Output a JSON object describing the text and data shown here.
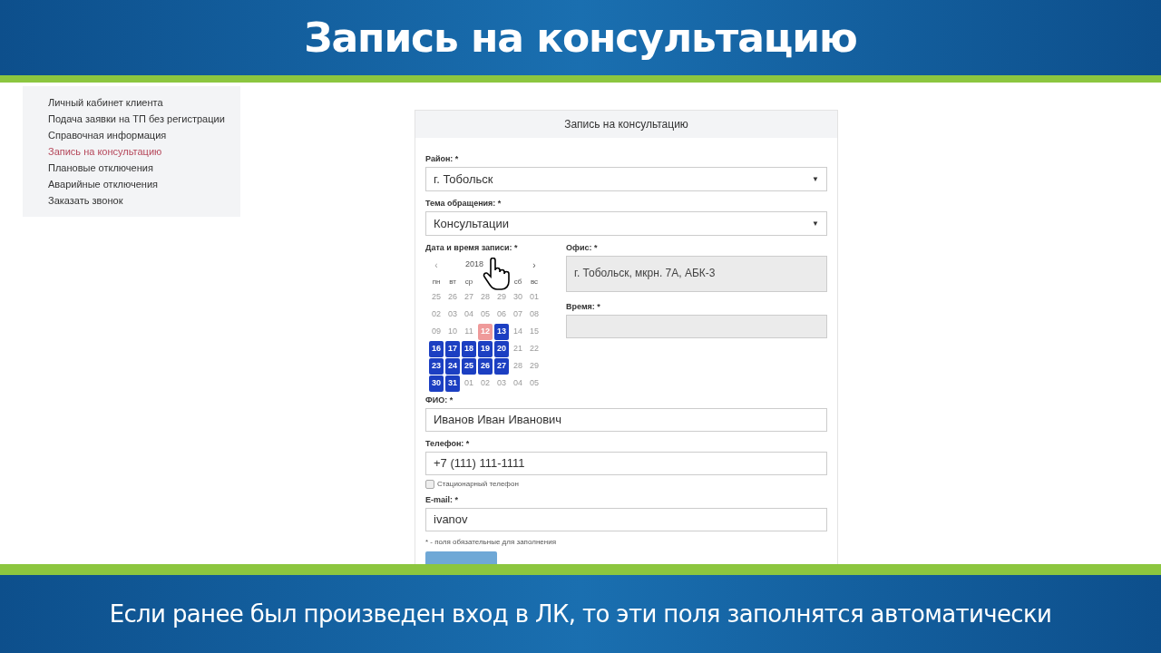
{
  "header": {
    "title": "Запись на консультацию"
  },
  "sidebar": {
    "items": [
      {
        "label": "Личный кабинет клиента",
        "selected": false
      },
      {
        "label": "Подача заявки на ТП без регистрации",
        "selected": false
      },
      {
        "label": "Справочная информация",
        "selected": false
      },
      {
        "label": "Запись на консультацию",
        "selected": true
      },
      {
        "label": "Плановые отключения",
        "selected": false
      },
      {
        "label": "Аварийные отключения",
        "selected": false
      },
      {
        "label": "Заказать звонок",
        "selected": false
      }
    ]
  },
  "form": {
    "title": "Запись на консультацию",
    "district": {
      "label": "Район: *",
      "value": "г. Тобольск",
      "caret": "▼"
    },
    "topic": {
      "label": "Тема обращения: *",
      "value": "Консультации",
      "caret": "▼"
    },
    "datetime": {
      "label": "Дата и время записи: *",
      "calendar": {
        "title": "2018",
        "prev": "‹",
        "next": "›",
        "weekdays": [
          {
            "kind": "label",
            "label": "пн"
          },
          {
            "kind": "label",
            "label": "вт"
          },
          {
            "kind": "label",
            "label": "ср"
          },
          {
            "kind": "covered"
          },
          {
            "kind": "covered"
          },
          {
            "kind": "label",
            "label": "сб"
          },
          {
            "kind": "label",
            "label": "вс"
          }
        ],
        "days": [
          {
            "label": "25",
            "kind": "inactive"
          },
          {
            "label": "26",
            "kind": "inactive"
          },
          {
            "label": "27",
            "kind": "inactive"
          },
          {
            "label": "28",
            "kind": "inactive"
          },
          {
            "label": "29",
            "kind": "inactive"
          },
          {
            "label": "30",
            "kind": "inactive"
          },
          {
            "label": "01",
            "kind": "inactive"
          },
          {
            "label": "02",
            "kind": "inactive"
          },
          {
            "label": "03",
            "kind": "inactive"
          },
          {
            "label": "04",
            "kind": "inactive"
          },
          {
            "label": "05",
            "kind": "inactive"
          },
          {
            "label": "06",
            "kind": "inactive"
          },
          {
            "label": "07",
            "kind": "inactive"
          },
          {
            "label": "08",
            "kind": "inactive"
          },
          {
            "label": "09",
            "kind": "inactive"
          },
          {
            "label": "10",
            "kind": "inactive"
          },
          {
            "label": "11",
            "kind": "inactive"
          },
          {
            "label": "12",
            "kind": "today"
          },
          {
            "label": "13",
            "kind": "available"
          },
          {
            "label": "14",
            "kind": "inactive"
          },
          {
            "label": "15",
            "kind": "inactive"
          },
          {
            "label": "16",
            "kind": "available"
          },
          {
            "label": "17",
            "kind": "available"
          },
          {
            "label": "18",
            "kind": "available"
          },
          {
            "label": "19",
            "kind": "available"
          },
          {
            "label": "20",
            "kind": "available"
          },
          {
            "label": "21",
            "kind": "inactive"
          },
          {
            "label": "22",
            "kind": "inactive"
          },
          {
            "label": "23",
            "kind": "available"
          },
          {
            "label": "24",
            "kind": "available"
          },
          {
            "label": "25",
            "kind": "available"
          },
          {
            "label": "26",
            "kind": "available"
          },
          {
            "label": "27",
            "kind": "available"
          },
          {
            "label": "28",
            "kind": "inactive"
          },
          {
            "label": "29",
            "kind": "inactive"
          },
          {
            "label": "30",
            "kind": "available"
          },
          {
            "label": "31",
            "kind": "available"
          },
          {
            "label": "01",
            "kind": "inactive"
          },
          {
            "label": "02",
            "kind": "inactive"
          },
          {
            "label": "03",
            "kind": "inactive"
          },
          {
            "label": "04",
            "kind": "inactive"
          },
          {
            "label": "05",
            "kind": "inactive"
          }
        ]
      }
    },
    "office": {
      "label": "Офис: *",
      "value": "г. Тобольск, мкрн. 7А, АБК-3",
      "disabled": true
    },
    "time": {
      "label": "Время: *",
      "disabled": true
    },
    "name": {
      "label": "ФИО: *",
      "value": "Иванов Иван Иванович"
    },
    "phone": {
      "label": "Телефон: *",
      "value": "+7 (111) 111-1111"
    },
    "landline": {
      "label": "Стационарный телефон",
      "checked": false
    },
    "email": {
      "label": "E-mail: *",
      "value": "ivanov"
    },
    "note": "* - поля обязательные для заполнения"
  },
  "caption": "Если ранее был произведен вход в ЛК, то эти поля заполнятся автоматически"
}
